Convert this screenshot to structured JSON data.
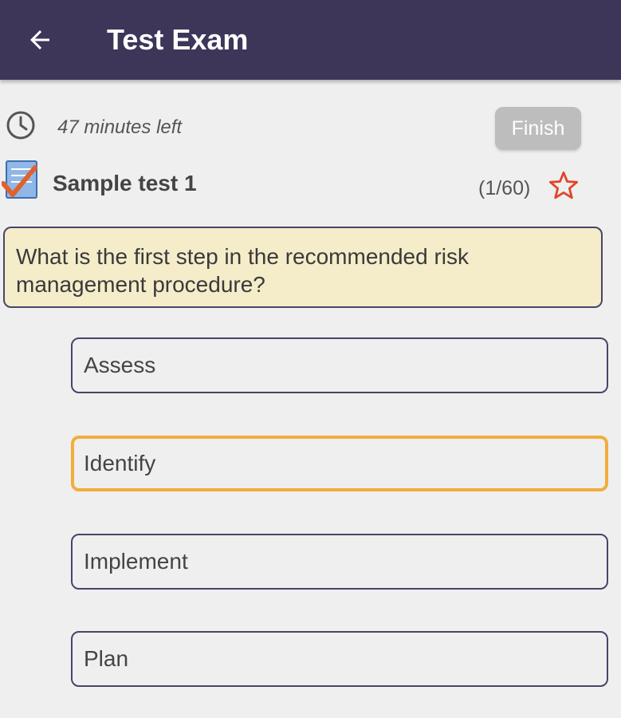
{
  "appbar": {
    "title": "Test Exam",
    "back_icon": "arrow-left-icon",
    "background": "#3d3659"
  },
  "timer": {
    "icon": "clock-icon",
    "text": "47 minutes left"
  },
  "finish_button": {
    "label": "Finish",
    "enabled": false
  },
  "test": {
    "icon": "checklist-icon",
    "name": "Sample test 1",
    "counter": "(1/60)",
    "bookmark_icon": "star-outline-icon",
    "accent": "#e0452b"
  },
  "question": {
    "text": "What is the first step in the recommended risk management procedure?"
  },
  "options": [
    {
      "label": "Assess",
      "selected": false
    },
    {
      "label": "Identify",
      "selected": true
    },
    {
      "label": "Implement",
      "selected": false
    },
    {
      "label": "Plan",
      "selected": false
    }
  ],
  "colors": {
    "selected_border": "#f2ad3c",
    "option_border": "#4a4468",
    "question_background": "#f5ecca"
  }
}
